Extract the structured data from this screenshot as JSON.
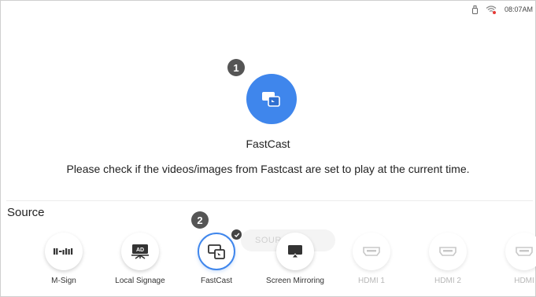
{
  "status_bar": {
    "time": "08:07AM",
    "icons": [
      "usb-icon",
      "wifi-alert-icon"
    ]
  },
  "hero": {
    "step_badge": "1",
    "icon": "fastcast-icon",
    "title": "FastCast",
    "message": "Please check if the videos/images from Fastcast are set to play at the current time."
  },
  "source": {
    "heading": "Source",
    "step_badge": "2",
    "tooltip_text": "SOURCE",
    "items": [
      {
        "label": "M-Sign",
        "icon": "msign-icon"
      },
      {
        "label": "Local Signage",
        "icon": "local-signage-icon"
      },
      {
        "label": "FastCast",
        "icon": "fastcast-icon"
      },
      {
        "label": "Screen Mirroring",
        "icon": "screen-mirroring-icon"
      },
      {
        "label": "HDMI 1",
        "icon": "hdmi-icon"
      },
      {
        "label": "HDMI 2",
        "icon": "hdmi-icon"
      },
      {
        "label": "HDMI",
        "icon": "hdmi-icon"
      }
    ],
    "selected_item": "FastCast",
    "accent_color": "#3f86ec"
  }
}
